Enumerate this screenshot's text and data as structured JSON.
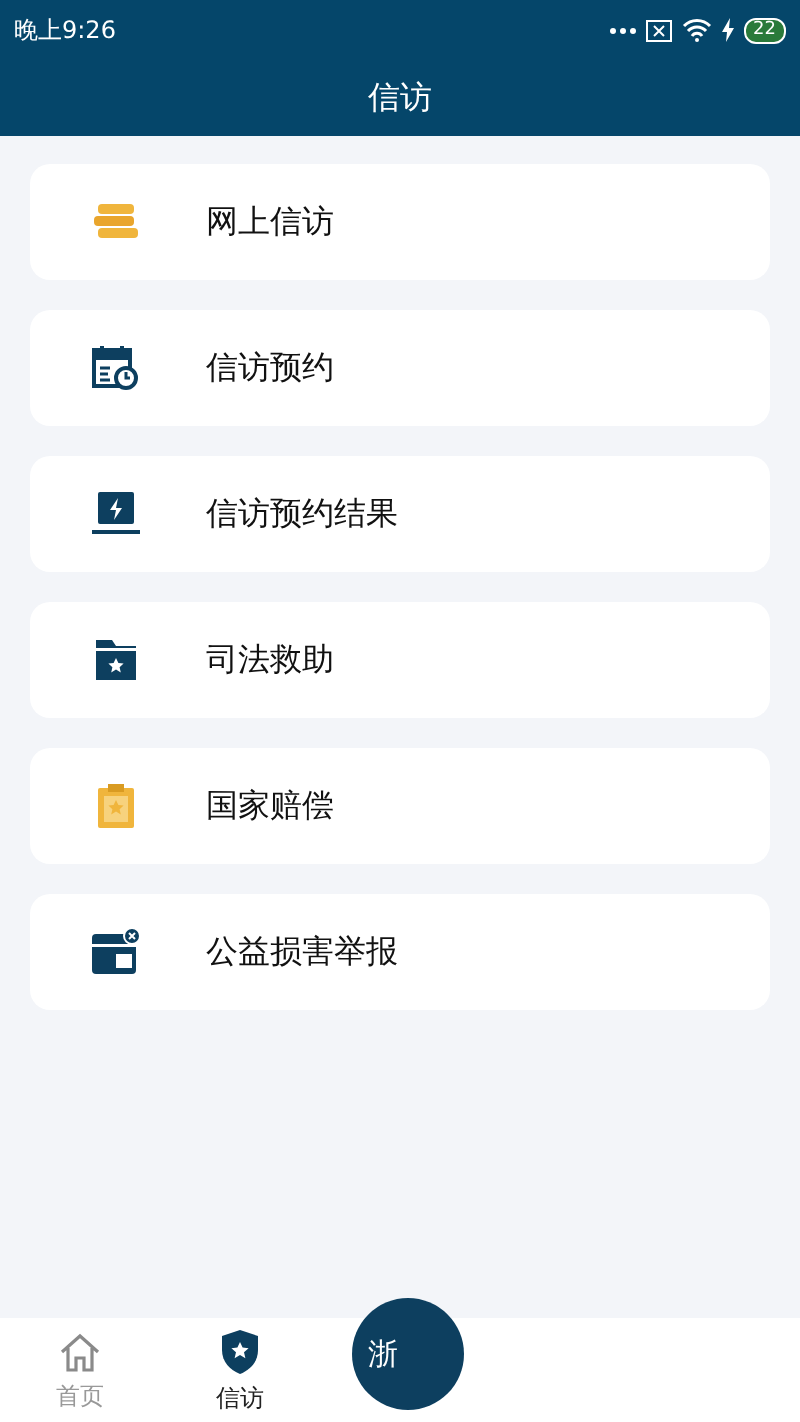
{
  "status_bar": {
    "time": "晚上9:26",
    "battery": "22"
  },
  "header": {
    "title": "信访"
  },
  "menu_items": [
    {
      "label": "网上信访",
      "kind": "books"
    },
    {
      "label": "信访预约",
      "kind": "calendar"
    },
    {
      "label": "信访预约结果",
      "kind": "laptop"
    },
    {
      "label": "司法救助",
      "kind": "folder"
    },
    {
      "label": "国家赔偿",
      "kind": "clipboard"
    },
    {
      "label": "公益损害举报",
      "kind": "card"
    }
  ],
  "tab_bar": {
    "tabs": [
      {
        "label": "首页",
        "kind": "home",
        "selected": false
      },
      {
        "label": "信访",
        "kind": "shield",
        "selected": true
      }
    ],
    "center_button": "浙"
  }
}
